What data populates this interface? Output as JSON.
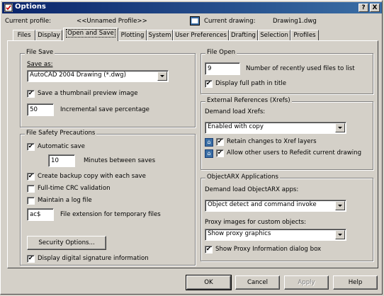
{
  "title": "Options",
  "title_buttons": {
    "help": "?",
    "close": "X"
  },
  "profile": {
    "label": "Current profile:",
    "value": "<<Unnamed Profile>>"
  },
  "drawing": {
    "label": "Current drawing:",
    "value": "Drawing1.dwg"
  },
  "tabs": [
    "Files",
    "Display",
    "Open and Save",
    "Plotting",
    "System",
    "User Preferences",
    "Drafting",
    "Selection",
    "Profiles"
  ],
  "active_tab": "Open and Save",
  "file_save": {
    "title": "File Save",
    "save_as_label": "Save as:",
    "save_as_value": "AutoCAD 2004 Drawing (*.dwg)",
    "thumbnail_label": "Save a thumbnail preview image",
    "thumbnail_checked": true,
    "incremental_value": "50",
    "incremental_label": "Incremental save percentage"
  },
  "file_safety": {
    "title": "File Safety Precautions",
    "automatic_save_label": "Automatic save",
    "automatic_save_checked": true,
    "minutes_value": "10",
    "minutes_label": "Minutes between saves",
    "backup_label": "Create backup copy with each save",
    "backup_checked": true,
    "crc_label": "Full-time CRC validation",
    "crc_checked": false,
    "log_label": "Maintain a log file",
    "log_checked": false,
    "ext_value": "ac$",
    "ext_label": "File extension for temporary files",
    "security_button": "Security Options...",
    "signature_label": "Display digital signature information",
    "signature_checked": true
  },
  "file_open": {
    "title": "File Open",
    "recent_value": "9",
    "recent_label": "Number of recently used files to list",
    "full_path_label": "Display full path in title",
    "full_path_checked": true
  },
  "xrefs": {
    "title": "External References (Xrefs)",
    "demand_label": "Demand load Xrefs:",
    "demand_value": "Enabled with copy",
    "retain_label": "Retain changes to Xref layers",
    "retain_checked": true,
    "allow_label": "Allow other users to Refedit current drawing",
    "allow_checked": true
  },
  "objectarx": {
    "title": "ObjectARX Applications",
    "demand_label": "Demand load ObjectARX apps:",
    "demand_value": "Object detect and command invoke",
    "proxy_label": "Proxy images for custom objects:",
    "proxy_value": "Show proxy graphics",
    "show_proxy_label": "Show Proxy Information dialog box",
    "show_proxy_checked": true
  },
  "buttons": {
    "ok": "OK",
    "cancel": "Cancel",
    "apply": "Apply",
    "help": "Help"
  },
  "colors": {
    "titlebar_start": "#0a246a",
    "titlebar_end": "#3a6ea5",
    "face": "#d4d0c8"
  }
}
